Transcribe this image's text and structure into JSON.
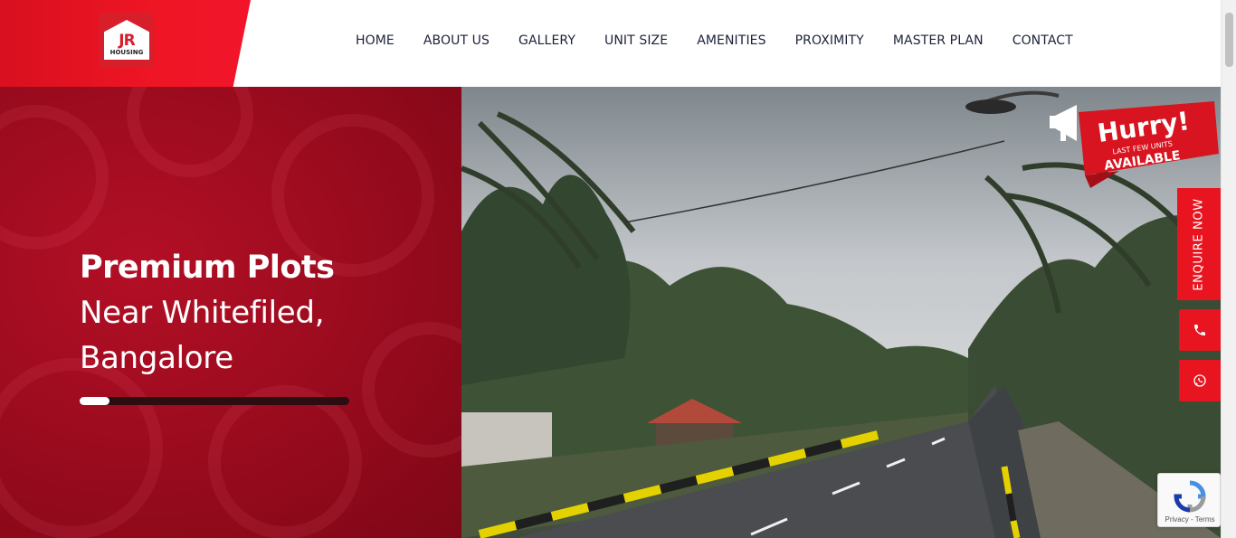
{
  "logo": {
    "main": "JR",
    "sub": "HOUSING"
  },
  "nav": {
    "items": [
      {
        "label": "HOME"
      },
      {
        "label": "ABOUT US"
      },
      {
        "label": "GALLERY"
      },
      {
        "label": "UNIT SIZE"
      },
      {
        "label": "AMENITIES"
      },
      {
        "label": "PROXIMITY"
      },
      {
        "label": "MASTER PLAN"
      },
      {
        "label": "CONTACT"
      }
    ]
  },
  "hero": {
    "title": "Premium Plots",
    "line2": "Near Whitefiled,",
    "line3": "Bangalore",
    "slider_progress": 0.11
  },
  "badge": {
    "headline": "Hurry!",
    "small": "LAST FEW UNITS",
    "big": "AVAILABLE"
  },
  "side": {
    "enquire_label": "ENQUIRE NOW",
    "phone_icon": "phone-icon",
    "whatsapp_icon": "whatsapp-icon"
  },
  "recaptcha": {
    "text": "Privacy - Terms"
  },
  "colors": {
    "brand_red": "#e8141f",
    "hero_red": "#9a0b1e",
    "nav_text": "#1c2238"
  }
}
